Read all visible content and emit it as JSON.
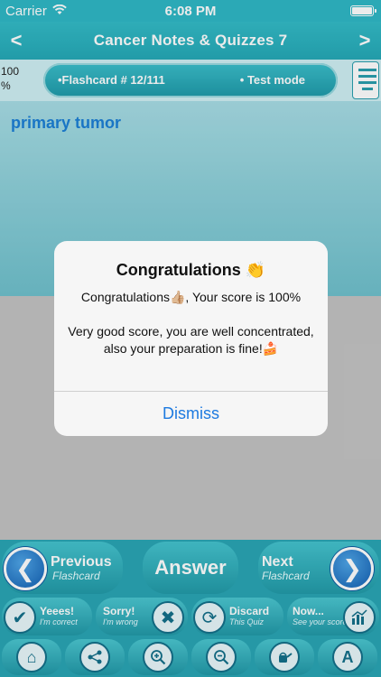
{
  "status_bar": {
    "carrier": "Carrier",
    "time": "6:08 PM"
  },
  "nav": {
    "title": "Cancer Notes & Quizzes 7",
    "back_glyph": "<",
    "forward_glyph": ">"
  },
  "info": {
    "percent_top": "100",
    "percent_bottom": "%",
    "flashcard": "•Flashcard #  12/111",
    "mode": "• Test mode"
  },
  "card": {
    "text": "primary tumor"
  },
  "alert": {
    "title": "Congratulations 👏",
    "line1": "Congratulations👍🏼, Your score is 100%",
    "line2": "Very good score, you are well concentrated, also your preparation is fine!🍰",
    "button": "Dismiss"
  },
  "toolbar": {
    "previous_title": "Previous",
    "previous_sub": "Flashcard",
    "answer": "Answer",
    "next_title": "Next",
    "next_sub": "Flashcard",
    "correct_title": "Yeees!",
    "correct_sub": "I'm correct",
    "wrong_title": "Sorry!",
    "wrong_sub": "I'm wrong",
    "discard_title": "Discard",
    "discard_sub": "This Quiz",
    "score_title": "Now...",
    "score_sub": "See your score",
    "icons": [
      "home-icon",
      "share-icon",
      "zoom-in-icon",
      "zoom-out-icon",
      "watering-can-icon",
      "font-icon"
    ]
  },
  "colors": {
    "accent": "#2aa5b5",
    "link": "#1d7ae0",
    "card_text": "#1c7fd6"
  }
}
